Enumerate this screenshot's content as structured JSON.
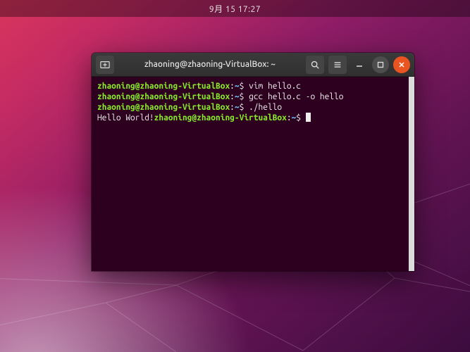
{
  "topbar": {
    "left_blur": "",
    "clock": "9月 15 17:27"
  },
  "window": {
    "title": "zhaoning@zhaoning-VirtualBox: ~"
  },
  "icons": {
    "new_tab": "new-tab-icon",
    "search": "search-icon",
    "menu": "hamburger-icon",
    "minimize": "minimize-icon",
    "maximize": "maximize-icon",
    "close": "close-icon"
  },
  "terminal": {
    "prompt_user": "zhaoning@zhaoning-VirtualBox",
    "prompt_sep": ":",
    "prompt_path": "~",
    "prompt_sym": "$ ",
    "lines": [
      {
        "cmd": "vim hello.c"
      },
      {
        "cmd": "gcc hello.c -o hello"
      },
      {
        "cmd": "./hello"
      }
    ],
    "output": "Hello World!"
  },
  "watermark": ""
}
